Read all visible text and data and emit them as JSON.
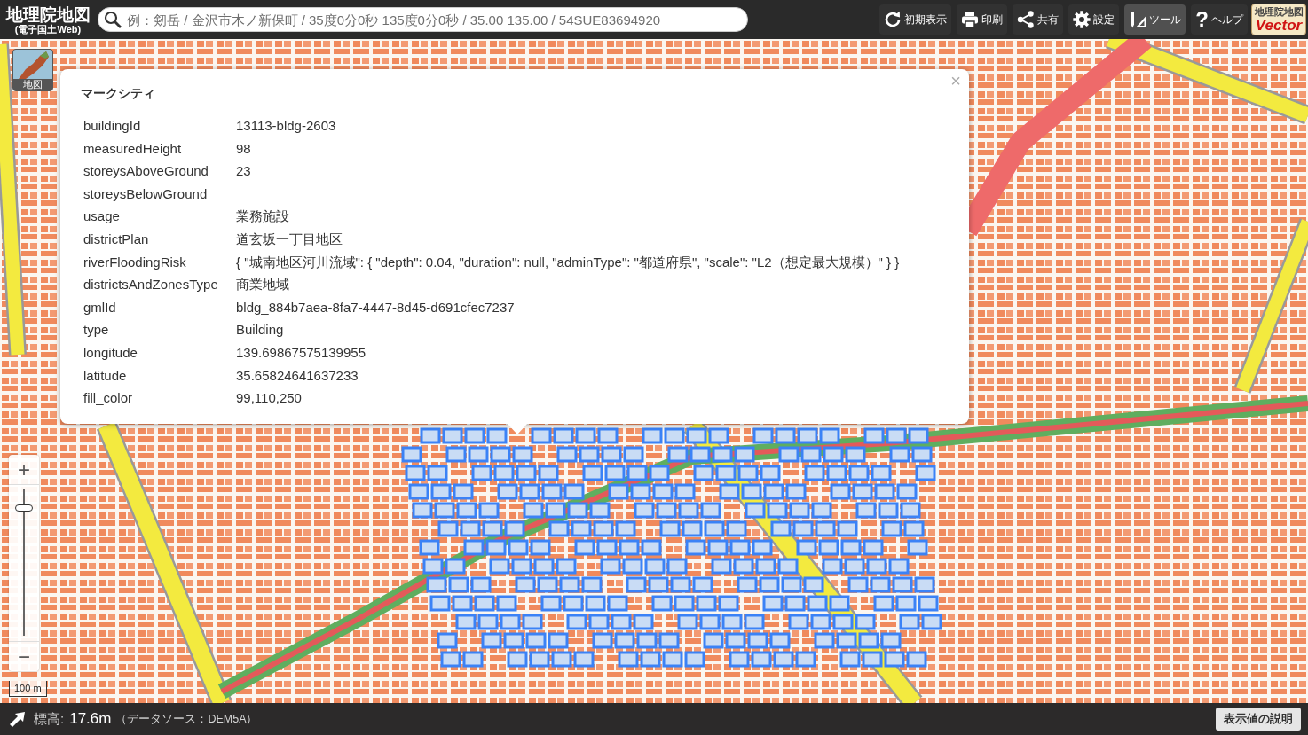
{
  "app": {
    "logo": {
      "title": "地理院地図",
      "subtitle": "(電子国土Web)"
    },
    "search": {
      "placeholder": "例：剱岳 / 金沢市木ノ新保町 / 35度0分0秒 135度0分0秒 / 35.00 135.00 / 54SUE83694920"
    },
    "toolbar": [
      {
        "kind": "refresh",
        "label": "初期表示",
        "selected": false
      },
      {
        "kind": "print",
        "label": "印刷",
        "selected": false
      },
      {
        "kind": "share",
        "label": "共有",
        "selected": false
      },
      {
        "kind": "settings",
        "label": "設定",
        "selected": false
      },
      {
        "kind": "tools",
        "label": "ツール",
        "selected": true
      },
      {
        "kind": "help",
        "symbol": "?",
        "label": "ヘルプ",
        "selected": false
      }
    ],
    "vector_badge": {
      "title": "地理院地図",
      "label": "Vector"
    }
  },
  "layer_button": {
    "label": "地図"
  },
  "popup": {
    "title": "マークシティ",
    "close": "×",
    "rows": [
      {
        "key": "buildingId",
        "value": "13113-bldg-2603"
      },
      {
        "key": "measuredHeight",
        "value": "98"
      },
      {
        "key": "storeysAboveGround",
        "value": "23"
      },
      {
        "key": "storeysBelowGround"
      },
      {
        "key": "usage",
        "value": "業務施設"
      },
      {
        "key": "districtPlan",
        "value": "道玄坂一丁目地区"
      },
      {
        "key": "riverFloodingRisk",
        "value": "{ \"城南地区河川流域\": { \"depth\": 0.04, \"duration\": null, \"adminType\": \"都道府県\", \"scale\": \"L2（想定最大規模）\" } }"
      },
      {
        "key": "districtsAndZonesType",
        "value": "商業地域"
      },
      {
        "key": "gmlId",
        "value": "bldg_884b7aea-8fa7-4447-8d45-d691cfec7237"
      },
      {
        "key": "type",
        "value": "Building"
      },
      {
        "key": "longitude",
        "value": "139.69867575139955"
      },
      {
        "key": "latitude",
        "value": "35.65824641637233"
      },
      {
        "key": "fill_color",
        "value": "99,110,250"
      }
    ]
  },
  "zoom": {
    "zoom_in": "+",
    "zoom_out": "−",
    "level": 0.87
  },
  "scale": "100 m",
  "status_bar": {
    "label": "標高:",
    "value": "17.6m",
    "source": "（データソース：DEM5A）",
    "button": "表示値の説明"
  }
}
